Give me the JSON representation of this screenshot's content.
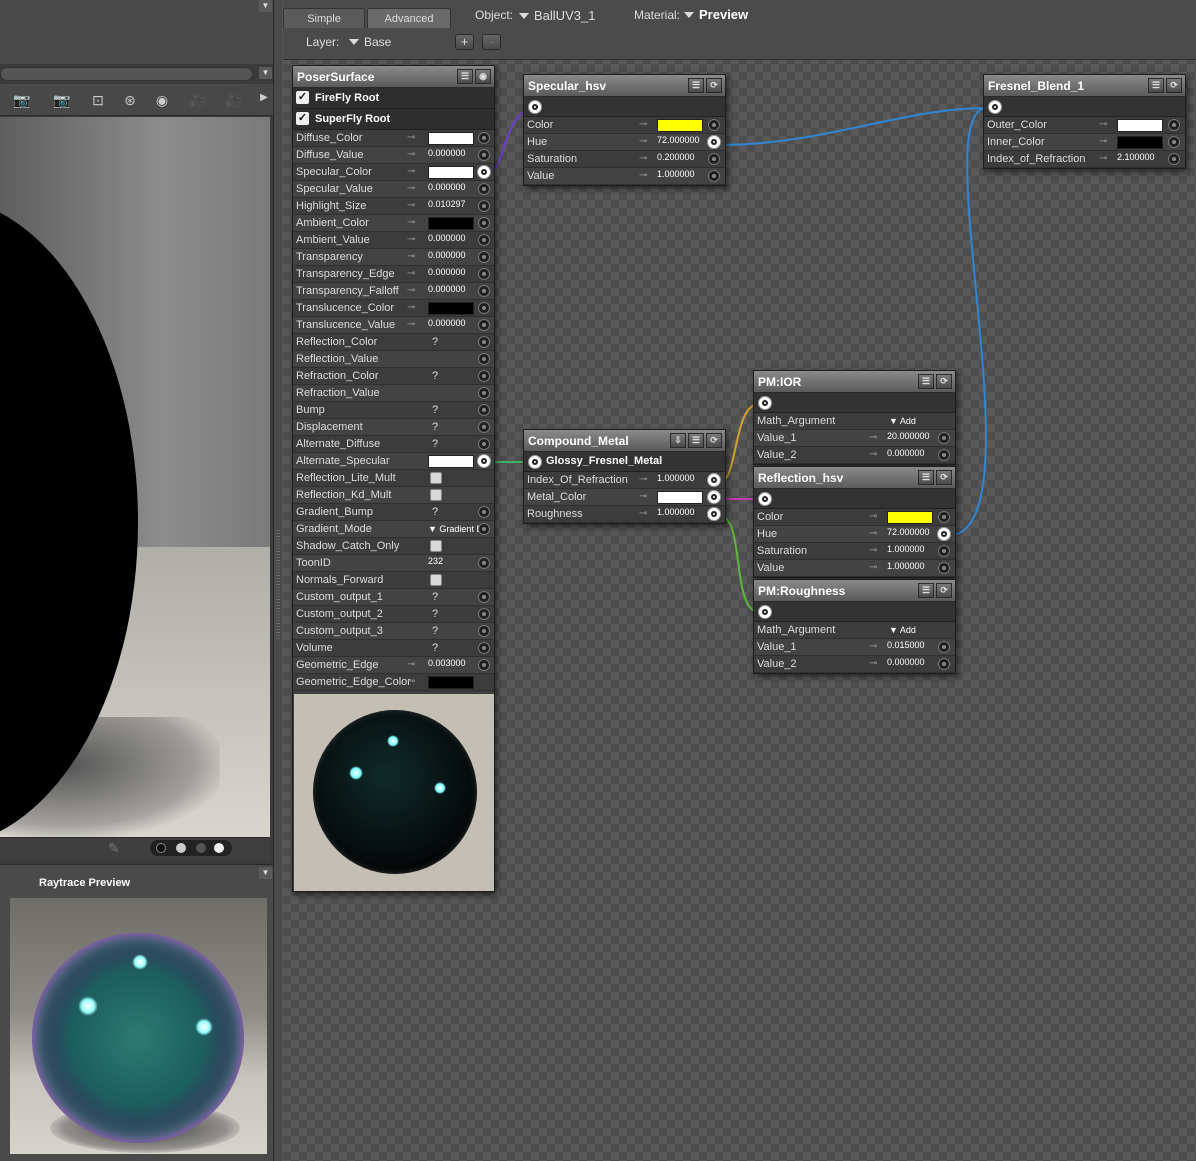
{
  "tabs": {
    "simple": "Simple",
    "advanced": "Advanced"
  },
  "object": {
    "label": "Object:",
    "value": "BallUV3_1"
  },
  "material": {
    "label": "Material:",
    "value": "Preview"
  },
  "layer": {
    "label": "Layer:",
    "value": "Base",
    "add": "+",
    "remove": "-"
  },
  "preview": {
    "title": "Raytrace Preview"
  },
  "poser": {
    "title": "PoserSurface",
    "firefly": "FireFly Root",
    "superfly": "SuperFly Root",
    "rows": [
      {
        "n": "Diffuse_Color",
        "t": "color",
        "c": "#ffffff",
        "k": 1,
        "s": 1
      },
      {
        "n": "Diffuse_Value",
        "t": "val",
        "v": "0.000000",
        "k": 1,
        "s": 1
      },
      {
        "n": "Specular_Color",
        "t": "color",
        "c": "#ffffff",
        "k": 1,
        "o": 1
      },
      {
        "n": "Specular_Value",
        "t": "val",
        "v": "0.000000",
        "k": 1,
        "s": 1
      },
      {
        "n": "Highlight_Size",
        "t": "val",
        "v": "0.010297",
        "k": 1,
        "s": 1
      },
      {
        "n": "Ambient_Color",
        "t": "color",
        "c": "#000000",
        "k": 1,
        "s": 1
      },
      {
        "n": "Ambient_Value",
        "t": "val",
        "v": "0.000000",
        "k": 1,
        "s": 1
      },
      {
        "n": "Transparency",
        "t": "val",
        "v": "0.000000",
        "k": 1,
        "s": 1
      },
      {
        "n": "Transparency_Edge",
        "t": "val",
        "v": "0.000000",
        "k": 1,
        "s": 1
      },
      {
        "n": "Transparency_Falloff",
        "t": "val",
        "v": "0.000000",
        "k": 1,
        "s": 1
      },
      {
        "n": "Translucence_Color",
        "t": "color",
        "c": "#000000",
        "k": 1,
        "s": 1
      },
      {
        "n": "Translucence_Value",
        "t": "val",
        "v": "0.000000",
        "k": 1,
        "s": 1
      },
      {
        "n": "Reflection_Color",
        "t": "q",
        "v": "?",
        "s": 1
      },
      {
        "n": "Reflection_Value",
        "t": "none",
        "s": 1
      },
      {
        "n": "Refraction_Color",
        "t": "q",
        "v": "?",
        "s": 1
      },
      {
        "n": "Refraction_Value",
        "t": "none",
        "s": 1
      },
      {
        "n": "Bump",
        "t": "q",
        "v": "?",
        "s": 1
      },
      {
        "n": "Displacement",
        "t": "q",
        "v": "?",
        "s": 1
      },
      {
        "n": "Alternate_Diffuse",
        "t": "q",
        "v": "?",
        "s": 1
      },
      {
        "n": "Alternate_Specular",
        "t": "color",
        "c": "#ffffff",
        "o": 1
      },
      {
        "n": "Reflection_Lite_Mult",
        "t": "cb"
      },
      {
        "n": "Reflection_Kd_Mult",
        "t": "cb"
      },
      {
        "n": "Gradient_Bump",
        "t": "q",
        "v": "?",
        "s": 1
      },
      {
        "n": "Gradient_Mode",
        "t": "dd",
        "v": "Gradient B...",
        "s": 1
      },
      {
        "n": "Shadow_Catch_Only",
        "t": "cb"
      },
      {
        "n": "ToonID",
        "t": "val",
        "v": "232",
        "s": 1
      },
      {
        "n": "Normals_Forward",
        "t": "cb"
      },
      {
        "n": "Custom_output_1",
        "t": "q",
        "v": "?",
        "s": 1
      },
      {
        "n": "Custom_output_2",
        "t": "q",
        "v": "?",
        "s": 1
      },
      {
        "n": "Custom_output_3",
        "t": "q",
        "v": "?",
        "s": 1
      },
      {
        "n": "Volume",
        "t": "q",
        "v": "?",
        "s": 1
      },
      {
        "n": "Geometric_Edge",
        "t": "val",
        "v": "0.003000",
        "k": 1,
        "s": 1
      },
      {
        "n": "Geometric_Edge_Color",
        "t": "color",
        "c": "#000000",
        "k": 1
      }
    ]
  },
  "specular_hsv": {
    "title": "Specular_hsv",
    "rows": [
      {
        "n": "Color",
        "t": "color",
        "c": "#ffff00",
        "k": 1,
        "s": 1
      },
      {
        "n": "Hue",
        "t": "val",
        "v": "72.000000",
        "k": 1,
        "o": 1
      },
      {
        "n": "Saturation",
        "t": "val",
        "v": "0.200000",
        "k": 1,
        "s": 1
      },
      {
        "n": "Value",
        "t": "val",
        "v": "1.000000",
        "k": 1,
        "s": 1
      }
    ]
  },
  "fresnel": {
    "title": "Fresnel_Blend_1",
    "rows": [
      {
        "n": "Outer_Color",
        "t": "color",
        "c": "#ffffff",
        "k": 1,
        "s": 1
      },
      {
        "n": "Inner_Color",
        "t": "color",
        "c": "#000000",
        "k": 1,
        "s": 1
      },
      {
        "n": "Index_of_Refraction",
        "t": "val",
        "v": "2.100000",
        "k": 1,
        "s": 1
      }
    ]
  },
  "compound": {
    "title": "Compound_Metal",
    "output": "Glossy_Fresnel_Metal",
    "rows": [
      {
        "n": "Index_Of_Refraction",
        "t": "val",
        "v": "1.000000",
        "k": 1,
        "o": 1
      },
      {
        "n": "Metal_Color",
        "t": "color",
        "c": "#ffffff",
        "k": 1,
        "o": 1
      },
      {
        "n": "Roughness",
        "t": "val",
        "v": "1.000000",
        "k": 1,
        "o": 1
      }
    ]
  },
  "pm_ior": {
    "title": "PM:IOR",
    "rows": [
      {
        "n": "Math_Argument",
        "t": "dd",
        "v": "Add"
      },
      {
        "n": "Value_1",
        "t": "val",
        "v": "20.000000",
        "k": 1,
        "s": 1
      },
      {
        "n": "Value_2",
        "t": "val",
        "v": "0.000000",
        "k": 1,
        "s": 1
      }
    ]
  },
  "refl_hsv": {
    "title": "Reflection_hsv",
    "rows": [
      {
        "n": "Color",
        "t": "color",
        "c": "#ffff00",
        "k": 1,
        "s": 1
      },
      {
        "n": "Hue",
        "t": "val",
        "v": "72.000000",
        "k": 1,
        "o": 1
      },
      {
        "n": "Saturation",
        "t": "val",
        "v": "1.000000",
        "k": 1,
        "s": 1
      },
      {
        "n": "Value",
        "t": "val",
        "v": "1.000000",
        "k": 1,
        "s": 1
      }
    ]
  },
  "pm_rough": {
    "title": "PM:Roughness",
    "rows": [
      {
        "n": "Math_Argument",
        "t": "dd",
        "v": "Add"
      },
      {
        "n": "Value_1",
        "t": "val",
        "v": "0.015000",
        "k": 1,
        "s": 1
      },
      {
        "n": "Value_2",
        "t": "val",
        "v": "0.000000",
        "k": 1,
        "s": 1
      }
    ]
  },
  "colors": {
    "wire_blue": "#2f86d6",
    "wire_purple": "#6b3fc9",
    "wire_green": "#3db36e",
    "wire_orange": "#d6a12c",
    "wire_magenta": "#c23bb0",
    "wire_lime": "#5ab83a"
  }
}
